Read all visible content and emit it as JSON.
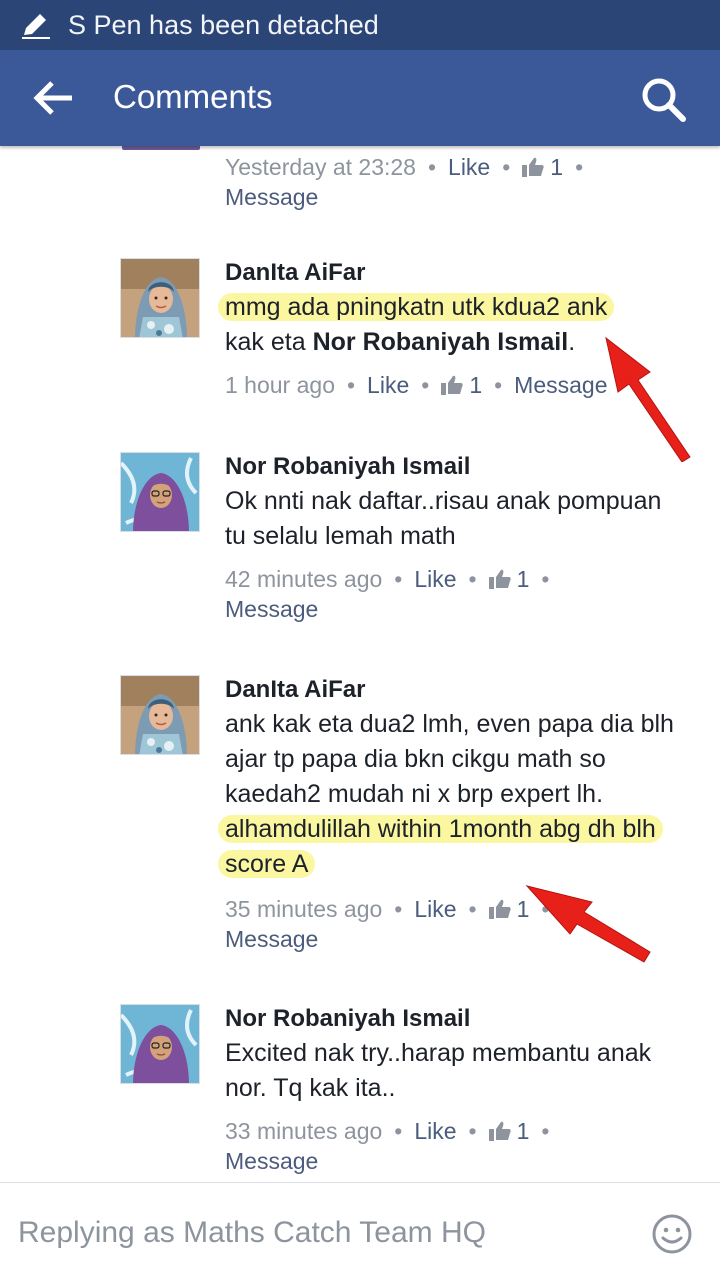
{
  "status_bar": {
    "text": "S Pen has been detached",
    "icon": "pen-icon"
  },
  "app_bar": {
    "title": "Comments",
    "back_icon": "back-arrow-icon",
    "search_icon": "search-icon"
  },
  "colors": {
    "header": "#3b5998",
    "status": "#2b4676",
    "highlight": "#fbf6a0",
    "arrow": "#e8201a"
  },
  "comments": [
    {
      "author": "",
      "timestamp": "Yesterday at 23:28",
      "like_label": "Like",
      "like_count": "1",
      "message_label": "Message"
    },
    {
      "author": "DanIta AiFar",
      "text_highlight": "mmg ada pningkatn utk kdua2 ank",
      "text_before_mention": "kak eta ",
      "mention": "Nor Robaniyah Ismail",
      "text_after_mention": ".",
      "timestamp": "1 hour ago",
      "like_label": "Like",
      "like_count": "1",
      "message_label": "Message"
    },
    {
      "author": "Nor Robaniyah Ismail",
      "text": "Ok nnti nak daftar..risau anak pompuan tu selalu lemah math",
      "timestamp": "42 minutes ago",
      "like_label": "Like",
      "like_count": "1",
      "message_label": "Message"
    },
    {
      "author": "DanIta AiFar",
      "text": "ank kak eta dua2 lmh, even papa dia blh ajar tp papa dia bkn cikgu math so kaedah2 mudah ni x brp expert lh.",
      "text_highlight": "alhamdulillah within 1month abg dh blh score A",
      "timestamp": "35 minutes ago",
      "like_label": "Like",
      "like_count": "1",
      "message_label": "Message"
    },
    {
      "author": "Nor Robaniyah Ismail",
      "text": "Excited nak try..harap membantu anak nor. Tq kak ita..",
      "timestamp": "33 minutes ago",
      "like_label": "Like",
      "like_count": "1",
      "message_label": "Message"
    }
  ],
  "reply_bar": {
    "placeholder": "Replying as Maths Catch Team HQ",
    "emoji_icon": "smiley-icon"
  }
}
